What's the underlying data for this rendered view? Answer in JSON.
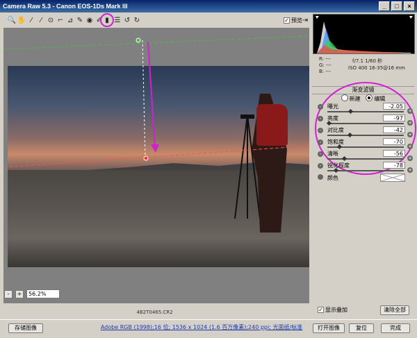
{
  "window": {
    "title": "Camera Raw 5.3 -  Canon EOS-1Ds Mark III"
  },
  "toolbar": {
    "tools": [
      "zoom-icon",
      "hand-icon",
      "white-balance-icon",
      "color-sampler-icon",
      "target-adjust-icon",
      "crop-icon",
      "straighten-icon",
      "spot-removal-icon",
      "red-eye-icon",
      "adjustment-brush-icon",
      "graduated-filter-icon",
      "preferences-icon",
      "rotate-ccw-icon",
      "rotate-cw-icon"
    ],
    "preview_label": "预览",
    "preview_checked": true
  },
  "image": {
    "filename": "4B2T0465.CR2",
    "zoom": "56.2%"
  },
  "info": {
    "r_label": "R:",
    "r_val": "---",
    "g_label": "G:",
    "g_val": "---",
    "b_label": "B:",
    "b_val": "---",
    "exposure": "f/7.1  1/60 秒",
    "iso": "ISO 400  16-35@16 mm"
  },
  "panel": {
    "title": "渐变滤镜",
    "mode_new": "新建",
    "mode_edit": "编辑",
    "mode_selected": "edit",
    "sliders": [
      {
        "label": "曝光",
        "value": "-2.05",
        "position": 0.3
      },
      {
        "label": "亮度",
        "value": "-97",
        "position": 0.02
      },
      {
        "label": "对比度",
        "value": "-42",
        "position": 0.29
      },
      {
        "label": "饱和度",
        "value": "-70",
        "position": 0.15
      },
      {
        "label": "清晰",
        "value": "-56",
        "position": 0.22
      },
      {
        "label": "锐化程度",
        "value": "-78",
        "position": 0.11
      }
    ],
    "color_label": "颜色"
  },
  "bottom_panel": {
    "show_overlay_label": "显示叠加",
    "show_overlay_checked": true,
    "clear_all_label": "清除全部"
  },
  "footer": {
    "save_label": "存储图像",
    "workflow_link": "Adobe RGB (1998);16 位; 1536 x 1024 (1.6 百万像素);240 ppi; 光面纸/标准",
    "open_label": "打开图像",
    "reset_label": "复位",
    "done_label": "完成"
  },
  "colors": {
    "accent": "#d020d0",
    "title_bg": "#0a246a",
    "link": "#1a3aa8"
  }
}
